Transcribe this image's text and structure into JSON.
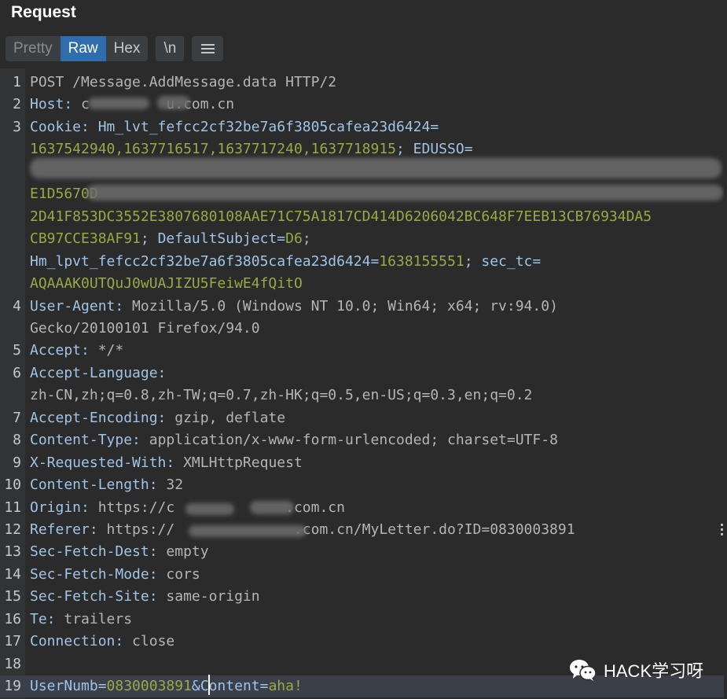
{
  "panel": {
    "title": "Request"
  },
  "toolbar": {
    "pretty_label": "Pretty",
    "raw_label": "Raw",
    "hex_label": "Hex",
    "newline_label": "\\n",
    "active_tab": "Raw"
  },
  "lines": [
    {
      "num": "1",
      "segs": [
        {
          "t": "POST /Message.AddMessage.data HTTP/2",
          "c": "v"
        }
      ]
    },
    {
      "num": "2",
      "segs": [
        {
          "t": "Host:",
          "c": "k"
        },
        {
          "t": " c         u.com.cn",
          "c": "v"
        }
      ]
    },
    {
      "num": "3",
      "segs": [
        {
          "t": "Cookie:",
          "c": "k"
        },
        {
          "t": " Hm_lvt_fefcc2cf32be7a6f3805cafea23d6424=",
          "c": "k"
        }
      ]
    },
    {
      "num": "",
      "segs": [
        {
          "t": "1637542940,1637716517,1637717240,1637718915",
          "c": "n"
        },
        {
          "t": "; EDUSSO=",
          "c": "k"
        }
      ]
    },
    {
      "num": "",
      "segs": [
        {
          "t": "",
          "c": "n"
        }
      ]
    },
    {
      "num": "",
      "segs": [
        {
          "t": "E1D5670D",
          "c": "n"
        }
      ]
    },
    {
      "num": "",
      "segs": [
        {
          "t": "2D41F853DC3552E3807680108AAE71C75A1817CD414D6206042BC648F7EEB13CB76934DA5",
          "c": "n"
        }
      ]
    },
    {
      "num": "",
      "segs": [
        {
          "t": "CB97CCE38AF91",
          "c": "n"
        },
        {
          "t": "; DefaultSubject=",
          "c": "k"
        },
        {
          "t": "D6",
          "c": "n"
        },
        {
          "t": ";",
          "c": "v"
        }
      ]
    },
    {
      "num": "",
      "segs": [
        {
          "t": "Hm_lpvt_fefcc2cf32be7a6f3805cafea23d6424=",
          "c": "k"
        },
        {
          "t": "1638155551",
          "c": "n"
        },
        {
          "t": "; sec_tc=",
          "c": "k"
        }
      ]
    },
    {
      "num": "",
      "segs": [
        {
          "t": "AQAAAK0UTQuJ0wUAJIZU5FeiwE4fQitO",
          "c": "n"
        }
      ]
    },
    {
      "num": "4",
      "segs": [
        {
          "t": "User-Agent:",
          "c": "k"
        },
        {
          "t": " Mozilla/5.0 (Windows NT 10.0; Win64; x64; rv:94.0)",
          "c": "v"
        }
      ]
    },
    {
      "num": "",
      "segs": [
        {
          "t": "Gecko/20100101 Firefox/94.0",
          "c": "v"
        }
      ]
    },
    {
      "num": "5",
      "segs": [
        {
          "t": "Accept:",
          "c": "k"
        },
        {
          "t": " */*",
          "c": "v"
        }
      ]
    },
    {
      "num": "6",
      "segs": [
        {
          "t": "Accept-Language:",
          "c": "k"
        }
      ]
    },
    {
      "num": "",
      "segs": [
        {
          "t": "zh-CN,zh;q=0.8,zh-TW;q=0.7,zh-HK;q=0.5,en-US;q=0.3,en;q=0.2",
          "c": "v"
        }
      ]
    },
    {
      "num": "7",
      "segs": [
        {
          "t": "Accept-Encoding:",
          "c": "k"
        },
        {
          "t": " gzip, deflate",
          "c": "v"
        }
      ]
    },
    {
      "num": "8",
      "segs": [
        {
          "t": "Content-Type:",
          "c": "k"
        },
        {
          "t": " application/x-www-form-urlencoded; charset=UTF-8",
          "c": "v"
        }
      ]
    },
    {
      "num": "9",
      "segs": [
        {
          "t": "X-Requested-With:",
          "c": "k"
        },
        {
          "t": " XMLHttpRequest",
          "c": "v"
        }
      ]
    },
    {
      "num": "10",
      "segs": [
        {
          "t": "Content-Length:",
          "c": "k"
        },
        {
          "t": " 32",
          "c": "v"
        }
      ]
    },
    {
      "num": "11",
      "segs": [
        {
          "t": "Origin:",
          "c": "k"
        },
        {
          "t": " https://c             .com.cn",
          "c": "v"
        }
      ]
    },
    {
      "num": "12",
      "segs": [
        {
          "t": "Referer:",
          "c": "k"
        },
        {
          "t": " https://              .com.cn/MyLetter.do?ID=0830003891",
          "c": "v"
        }
      ]
    },
    {
      "num": "13",
      "segs": [
        {
          "t": "Sec-Fetch-Dest:",
          "c": "k"
        },
        {
          "t": " empty",
          "c": "v"
        }
      ]
    },
    {
      "num": "14",
      "segs": [
        {
          "t": "Sec-Fetch-Mode:",
          "c": "k"
        },
        {
          "t": " cors",
          "c": "v"
        }
      ]
    },
    {
      "num": "15",
      "segs": [
        {
          "t": "Sec-Fetch-Site:",
          "c": "k"
        },
        {
          "t": " same-origin",
          "c": "v"
        }
      ]
    },
    {
      "num": "16",
      "segs": [
        {
          "t": "Te:",
          "c": "k"
        },
        {
          "t": " trailers",
          "c": "v"
        }
      ]
    },
    {
      "num": "17",
      "segs": [
        {
          "t": "Connection:",
          "c": "k"
        },
        {
          "t": " close",
          "c": "v"
        }
      ]
    },
    {
      "num": "18",
      "segs": []
    },
    {
      "num": "19",
      "segs": [
        {
          "t": "UserNumb=",
          "c": "k"
        },
        {
          "t": "0830003891",
          "c": "n"
        },
        {
          "t": "&Content=",
          "c": "k"
        },
        {
          "t": "aha!",
          "c": "n"
        }
      ],
      "highlight": true
    }
  ],
  "watermark": {
    "text": "HACK学习呀",
    "icon": "wechat-icon"
  }
}
